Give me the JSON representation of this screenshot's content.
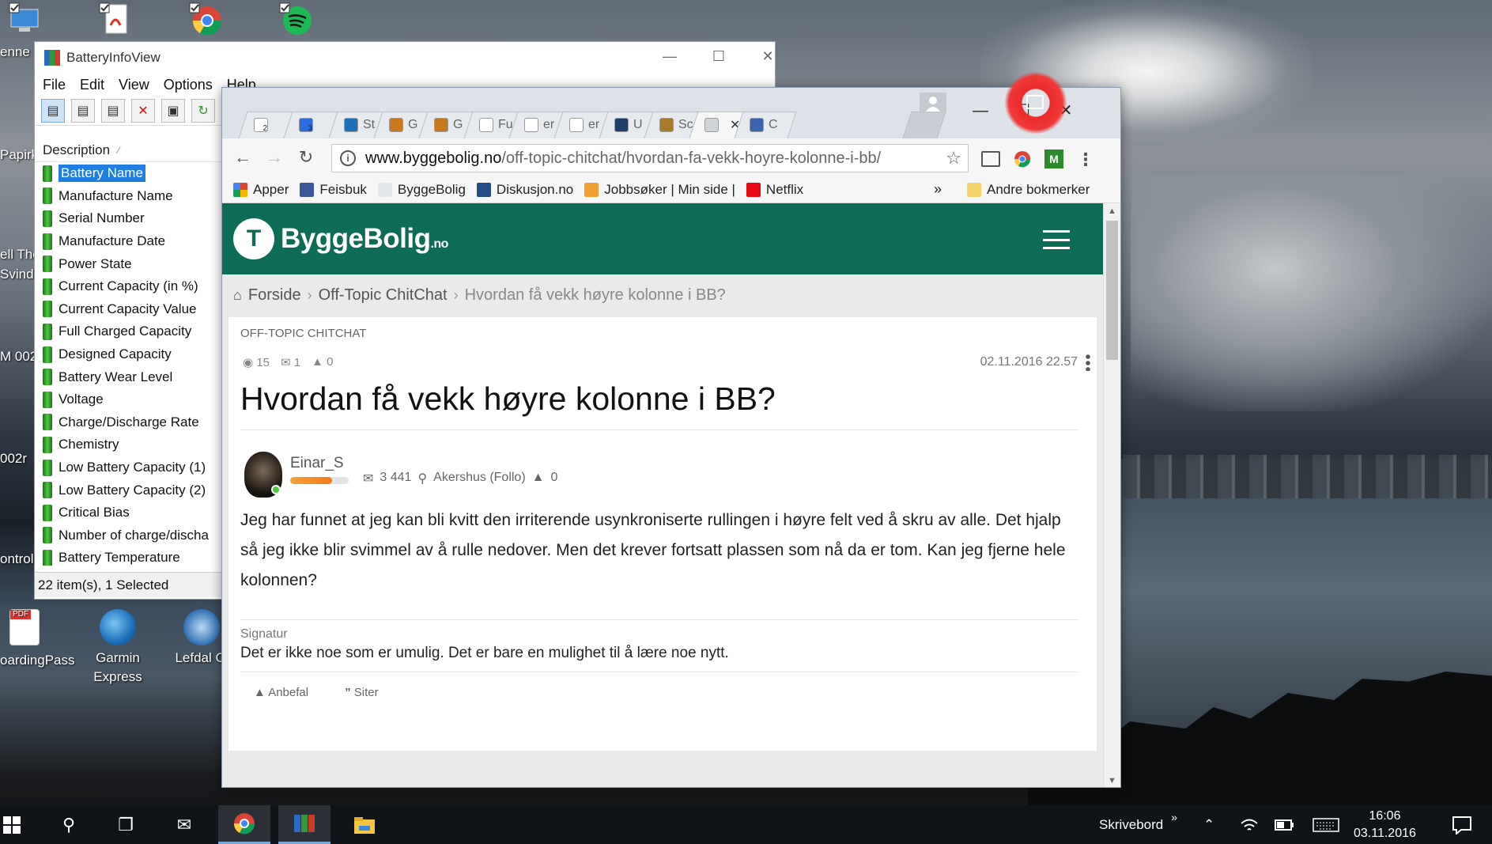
{
  "desktop": {
    "left_labels": [
      "enne",
      "Papirk",
      "ell The",
      "Svindl",
      "M 002",
      "002r",
      "ontroll",
      "oardingPass"
    ],
    "icons": [
      {
        "label": "Garmin Express"
      },
      {
        "label": "Lefdal Cl"
      }
    ]
  },
  "batteryinfoview": {
    "title": "BatteryInfoView",
    "menu": [
      "File",
      "Edit",
      "View",
      "Options",
      "Help"
    ],
    "column_header": "Description",
    "rows": [
      "Battery Name",
      "Manufacture Name",
      "Serial Number",
      "Manufacture Date",
      "Power State",
      "Current Capacity (in %)",
      "Current Capacity Value",
      "Full Charged Capacity",
      "Designed Capacity",
      "Battery Wear Level",
      "Voltage",
      "Charge/Discharge Rate",
      "Chemistry",
      "Low Battery Capacity (1)",
      "Low Battery Capacity (2)",
      "Critical Bias",
      "Number of charge/discha",
      "Battery Temperature"
    ],
    "selected_row": "Battery Name",
    "status": "22 item(s), 1 Selected"
  },
  "chrome": {
    "tabs": [
      {
        "label": "",
        "icon": "gmail-icon",
        "badge": "2"
      },
      {
        "label": "",
        "icon": "calendar-icon",
        "badge": "3"
      },
      {
        "label": "St",
        "icon": "p-icon"
      },
      {
        "label": "G",
        "icon": "globe-icon"
      },
      {
        "label": "G",
        "icon": "globe-icon"
      },
      {
        "label": "Fu",
        "icon": "doc-icon"
      },
      {
        "label": "er",
        "icon": "doc-icon"
      },
      {
        "label": "er",
        "icon": "doc-icon"
      },
      {
        "label": "U",
        "icon": "gear-icon"
      },
      {
        "label": "Sc",
        "icon": "crest-icon"
      },
      {
        "label": "",
        "icon": "byggebolig-icon",
        "active": true
      },
      {
        "label": "C",
        "icon": "site-icon"
      }
    ],
    "url_host": "www.byggebolig.no",
    "url_path": "/off-topic-chitchat/hvordan-fa-vekk-hoyre-kolonne-i-bb/",
    "bookmarks": [
      {
        "label": "Apper",
        "icon": "apps-grid-icon"
      },
      {
        "label": "Feisbuk",
        "icon": "facebook-icon"
      },
      {
        "label": "ByggeBolig",
        "icon": "byggebolig-icon"
      },
      {
        "label": "Diskusjon.no",
        "icon": "diskusjon-icon"
      },
      {
        "label": "Jobbsøker | Min side |",
        "icon": "search-icon"
      },
      {
        "label": "Netflix",
        "icon": "netflix-icon"
      }
    ],
    "bookmarks_overflow": "»",
    "other_bookmarks": "Andre bokmerker"
  },
  "site": {
    "logo_main": "ByggeBolig",
    "logo_suffix": ".no",
    "breadcrumbs": [
      "Forside",
      "Off-Topic ChitChat",
      "Hvordan få vekk høyre kolonne i BB?"
    ],
    "category": "OFF-TOPIC CHITCHAT",
    "views": "15",
    "comments": "1",
    "likes": "0",
    "date": "02.11.2016 22.57",
    "title": "Hvordan få vekk høyre kolonne i BB?",
    "author": "Einar_S",
    "reputation_fraction": 0.72,
    "author_posts": "3 441",
    "author_location": "Akershus (Follo)",
    "author_likes": "0",
    "body": "Jeg har funnet at jeg kan bli kvitt den irriterende usynkroniserte rullingen i høyre felt ved å skru av alle. Det hjalp så jeg ikke blir svimmel av å rulle nedover. Men det krever fortsatt plassen som nå da er tom. Kan jeg fjerne hele kolonnen?",
    "signature_label": "Signatur",
    "signature": "Det er ikke noe som er umulig. Det er bare en mulighet til å lære noe nytt.",
    "recommend": "Anbefal",
    "quote": "Siter"
  },
  "taskbar": {
    "desktop_label": "Skrivebord",
    "time": "16:06",
    "date": "03.11.2016"
  },
  "colors": {
    "site_green": "#0e6b56",
    "selection_blue": "#1e7fe0",
    "annotation_red": "#ec2b2b"
  }
}
